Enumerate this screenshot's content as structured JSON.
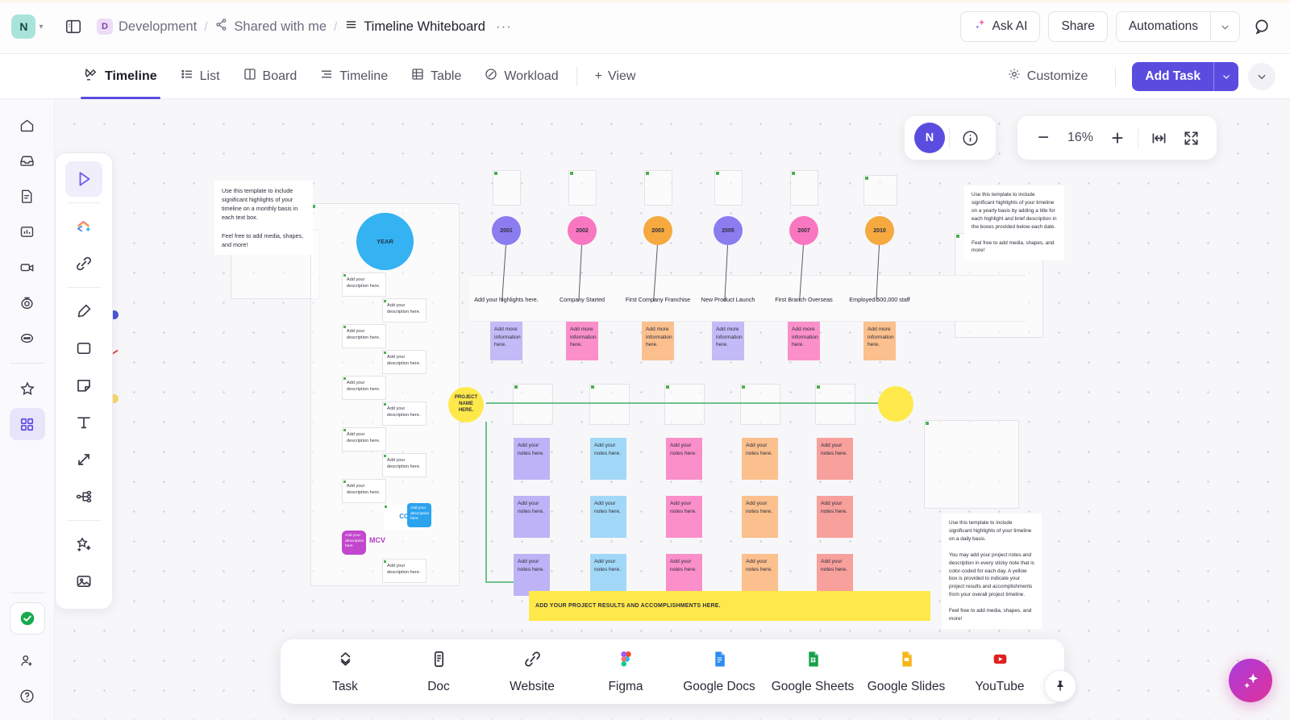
{
  "topbar": {
    "workspace_initial": "N",
    "breadcrumbs": [
      {
        "label": "Development",
        "chip": "D",
        "icon": "folder-chip-icon"
      },
      {
        "label": "Shared with me",
        "icon": "share-nodes-icon"
      },
      {
        "label": "Timeline Whiteboard",
        "icon": "list-lines-icon"
      }
    ],
    "more_dots": "···",
    "ask_ai": "Ask AI",
    "share": "Share",
    "automations": "Automations",
    "caret": "∨"
  },
  "viewbar": {
    "tabs": [
      {
        "label": "Timeline",
        "icon": "whiteboard-pen-icon",
        "active": true
      },
      {
        "label": "List",
        "icon": "list-icon",
        "active": false
      },
      {
        "label": "Board",
        "icon": "board-icon",
        "active": false
      },
      {
        "label": "Timeline",
        "icon": "timeline-icon",
        "active": false
      },
      {
        "label": "Table",
        "icon": "table-icon",
        "active": false
      },
      {
        "label": "Workload",
        "icon": "workload-icon",
        "active": false
      }
    ],
    "add_view": "View",
    "customize": "Customize",
    "add_task": "Add Task"
  },
  "rail": {
    "items": [
      {
        "name": "home-icon"
      },
      {
        "name": "inbox-icon"
      },
      {
        "name": "docs-icon"
      },
      {
        "name": "dashboards-icon"
      },
      {
        "name": "clips-icon"
      },
      {
        "name": "timer-icon"
      },
      {
        "name": "more-icon"
      }
    ],
    "favorites_icon": "star-icon",
    "spaces_icon": "grid-apps-icon",
    "check_icon": "green-check-icon",
    "invite_icon": "invite-user-icon",
    "help_icon": "help-circle-icon"
  },
  "whiteboard_tools": [
    {
      "name": "select-cursor-tool",
      "active": true
    },
    {
      "name": "shapes-add-tool",
      "active": false
    },
    {
      "name": "link-tool",
      "active": false
    },
    {
      "name": "marker-pen-tool",
      "active": false
    },
    {
      "name": "rectangle-tool",
      "active": false
    },
    {
      "name": "sticky-note-tool",
      "active": false
    },
    {
      "name": "text-tool",
      "active": false
    },
    {
      "name": "connector-arrow-tool",
      "active": false
    },
    {
      "name": "mindmap-tool",
      "active": false
    },
    {
      "name": "ai-magic-tool",
      "active": false
    },
    {
      "name": "image-tool",
      "active": false
    }
  ],
  "zoom_controls": {
    "presence_initial": "N",
    "info_icon": "info-icon",
    "minus": "−",
    "level": "16%",
    "plus": "+",
    "fit_width_icon": "fit-width-icon",
    "fullscreen_icon": "fullscreen-icon"
  },
  "board": {
    "note_monthly": "Use this template to include significant highlights of your timeline on a monthly basis in each text box.\n\nFeel free to add media, shapes, and more!",
    "note_yearly": "Use this template to include significant highlights of your timeline on a yearly basis by adding a title for each highlight and brief description in the boxes provided below each date.\n\nFeel free to add media, shapes, and more!",
    "note_daily": "Use this template to include significant highlights of your timeline on a daily basis.\n\nYou may add your project notes and description in every sticky note that is color-coded for each day. A yellow box is provided to indicate your project results and accomplishments from your overall project timeline.\n\nFeel free to add media, shapes, and more!",
    "year_bubble": "YEAR",
    "mindmap_box_text": "Add your description here.",
    "mindmap_accent_a": "CCT",
    "mindmap_accent_b": "MCV",
    "timeline_events": [
      {
        "year": "2001",
        "title": "Add your highlights here.",
        "note": "Add more information here.",
        "circle_color": "#8b7cf0",
        "note_color": "#c3bbf7"
      },
      {
        "year": "2002",
        "title": "Company Started",
        "note": "Add more information here.",
        "circle_color": "#f976c0",
        "note_color": "#fb8fc9"
      },
      {
        "year": "2003",
        "title": "First Company Franchise",
        "note": "Add more information here.",
        "circle_color": "#f5a93f",
        "note_color": "#fbc08d"
      },
      {
        "year": "2005",
        "title": "New Product Launch",
        "note": "Add more information here.",
        "circle_color": "#8b7cf0",
        "note_color": "#c3bbf7"
      },
      {
        "year": "2007",
        "title": "First Branch Overseas",
        "note": "Add more information here.",
        "circle_color": "#f976c0",
        "note_color": "#fb8fc9"
      },
      {
        "year": "2010",
        "title": "Employed 500,000 staff",
        "note": "Add more information here.",
        "circle_color": "#f5a93f",
        "note_color": "#fbc08d"
      }
    ],
    "project_name": "PROJECT NAME HERE.",
    "project_note_text": "Add your notes here.",
    "project_columns": [
      {
        "color": "#bdb3f6"
      },
      {
        "color": "#a2d8f7"
      },
      {
        "color": "#fb8fc9"
      },
      {
        "color": "#fbc08d"
      },
      {
        "color": "#f8a09c"
      }
    ],
    "project_rows": 3,
    "results_bar": "ADD YOUR PROJECT RESULTS AND ACCOMPLISHMENTS HERE."
  },
  "dock": {
    "items": [
      {
        "label": "Task",
        "icon": "clickup-task-icon"
      },
      {
        "label": "Doc",
        "icon": "doc-icon"
      },
      {
        "label": "Website",
        "icon": "link-website-icon"
      },
      {
        "label": "Figma",
        "icon": "figma-icon"
      },
      {
        "label": "Google Docs",
        "icon": "google-docs-icon"
      },
      {
        "label": "Google Sheets",
        "icon": "google-sheets-icon"
      },
      {
        "label": "Google Slides",
        "icon": "google-slides-icon"
      },
      {
        "label": "YouTube",
        "icon": "youtube-icon"
      }
    ],
    "pin_icon": "pin-icon",
    "ai_fab_icon": "ai-sparkle-icon"
  },
  "colors": {
    "accent": "#5b4ce0",
    "green": "#6dc28c",
    "yellow": "#ffe94a",
    "cyan": "#35b2f2"
  }
}
